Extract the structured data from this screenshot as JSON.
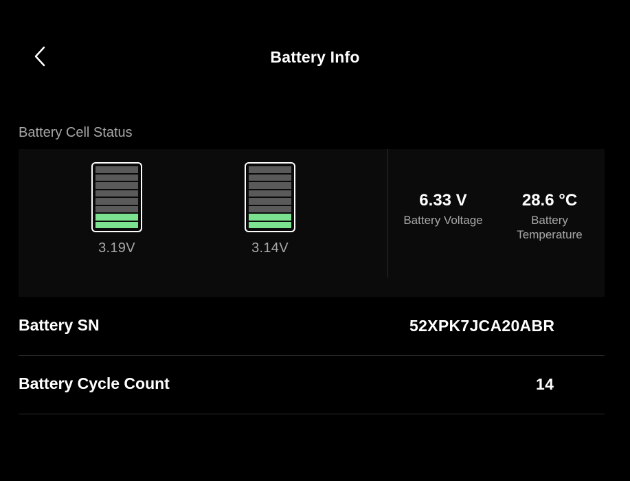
{
  "header": {
    "title": "Battery Info",
    "back_icon": "chevron-left-icon"
  },
  "cell_status": {
    "label": "Battery Cell Status",
    "cells": [
      {
        "voltage": "3.19V",
        "level_segments": 2,
        "total_segments": 8
      },
      {
        "voltage": "3.14V",
        "level_segments": 2,
        "total_segments": 8
      }
    ]
  },
  "stats": {
    "voltage": {
      "value": "6.33 V",
      "label": "Battery Voltage"
    },
    "temperature": {
      "value": "28.6 °C",
      "label_line1": "Battery",
      "label_line2": "Temperature"
    }
  },
  "details": {
    "sn": {
      "label": "Battery SN",
      "value": "52XPK7JCA20ABR"
    },
    "cycle": {
      "label": "Battery Cycle Count",
      "value": "14"
    }
  },
  "colors": {
    "background": "#000000",
    "panel": "#0b0b0b",
    "cell_fill": "#7be38f",
    "cell_empty": "#5a5a5a",
    "secondary_text": "#a8a8a8"
  }
}
